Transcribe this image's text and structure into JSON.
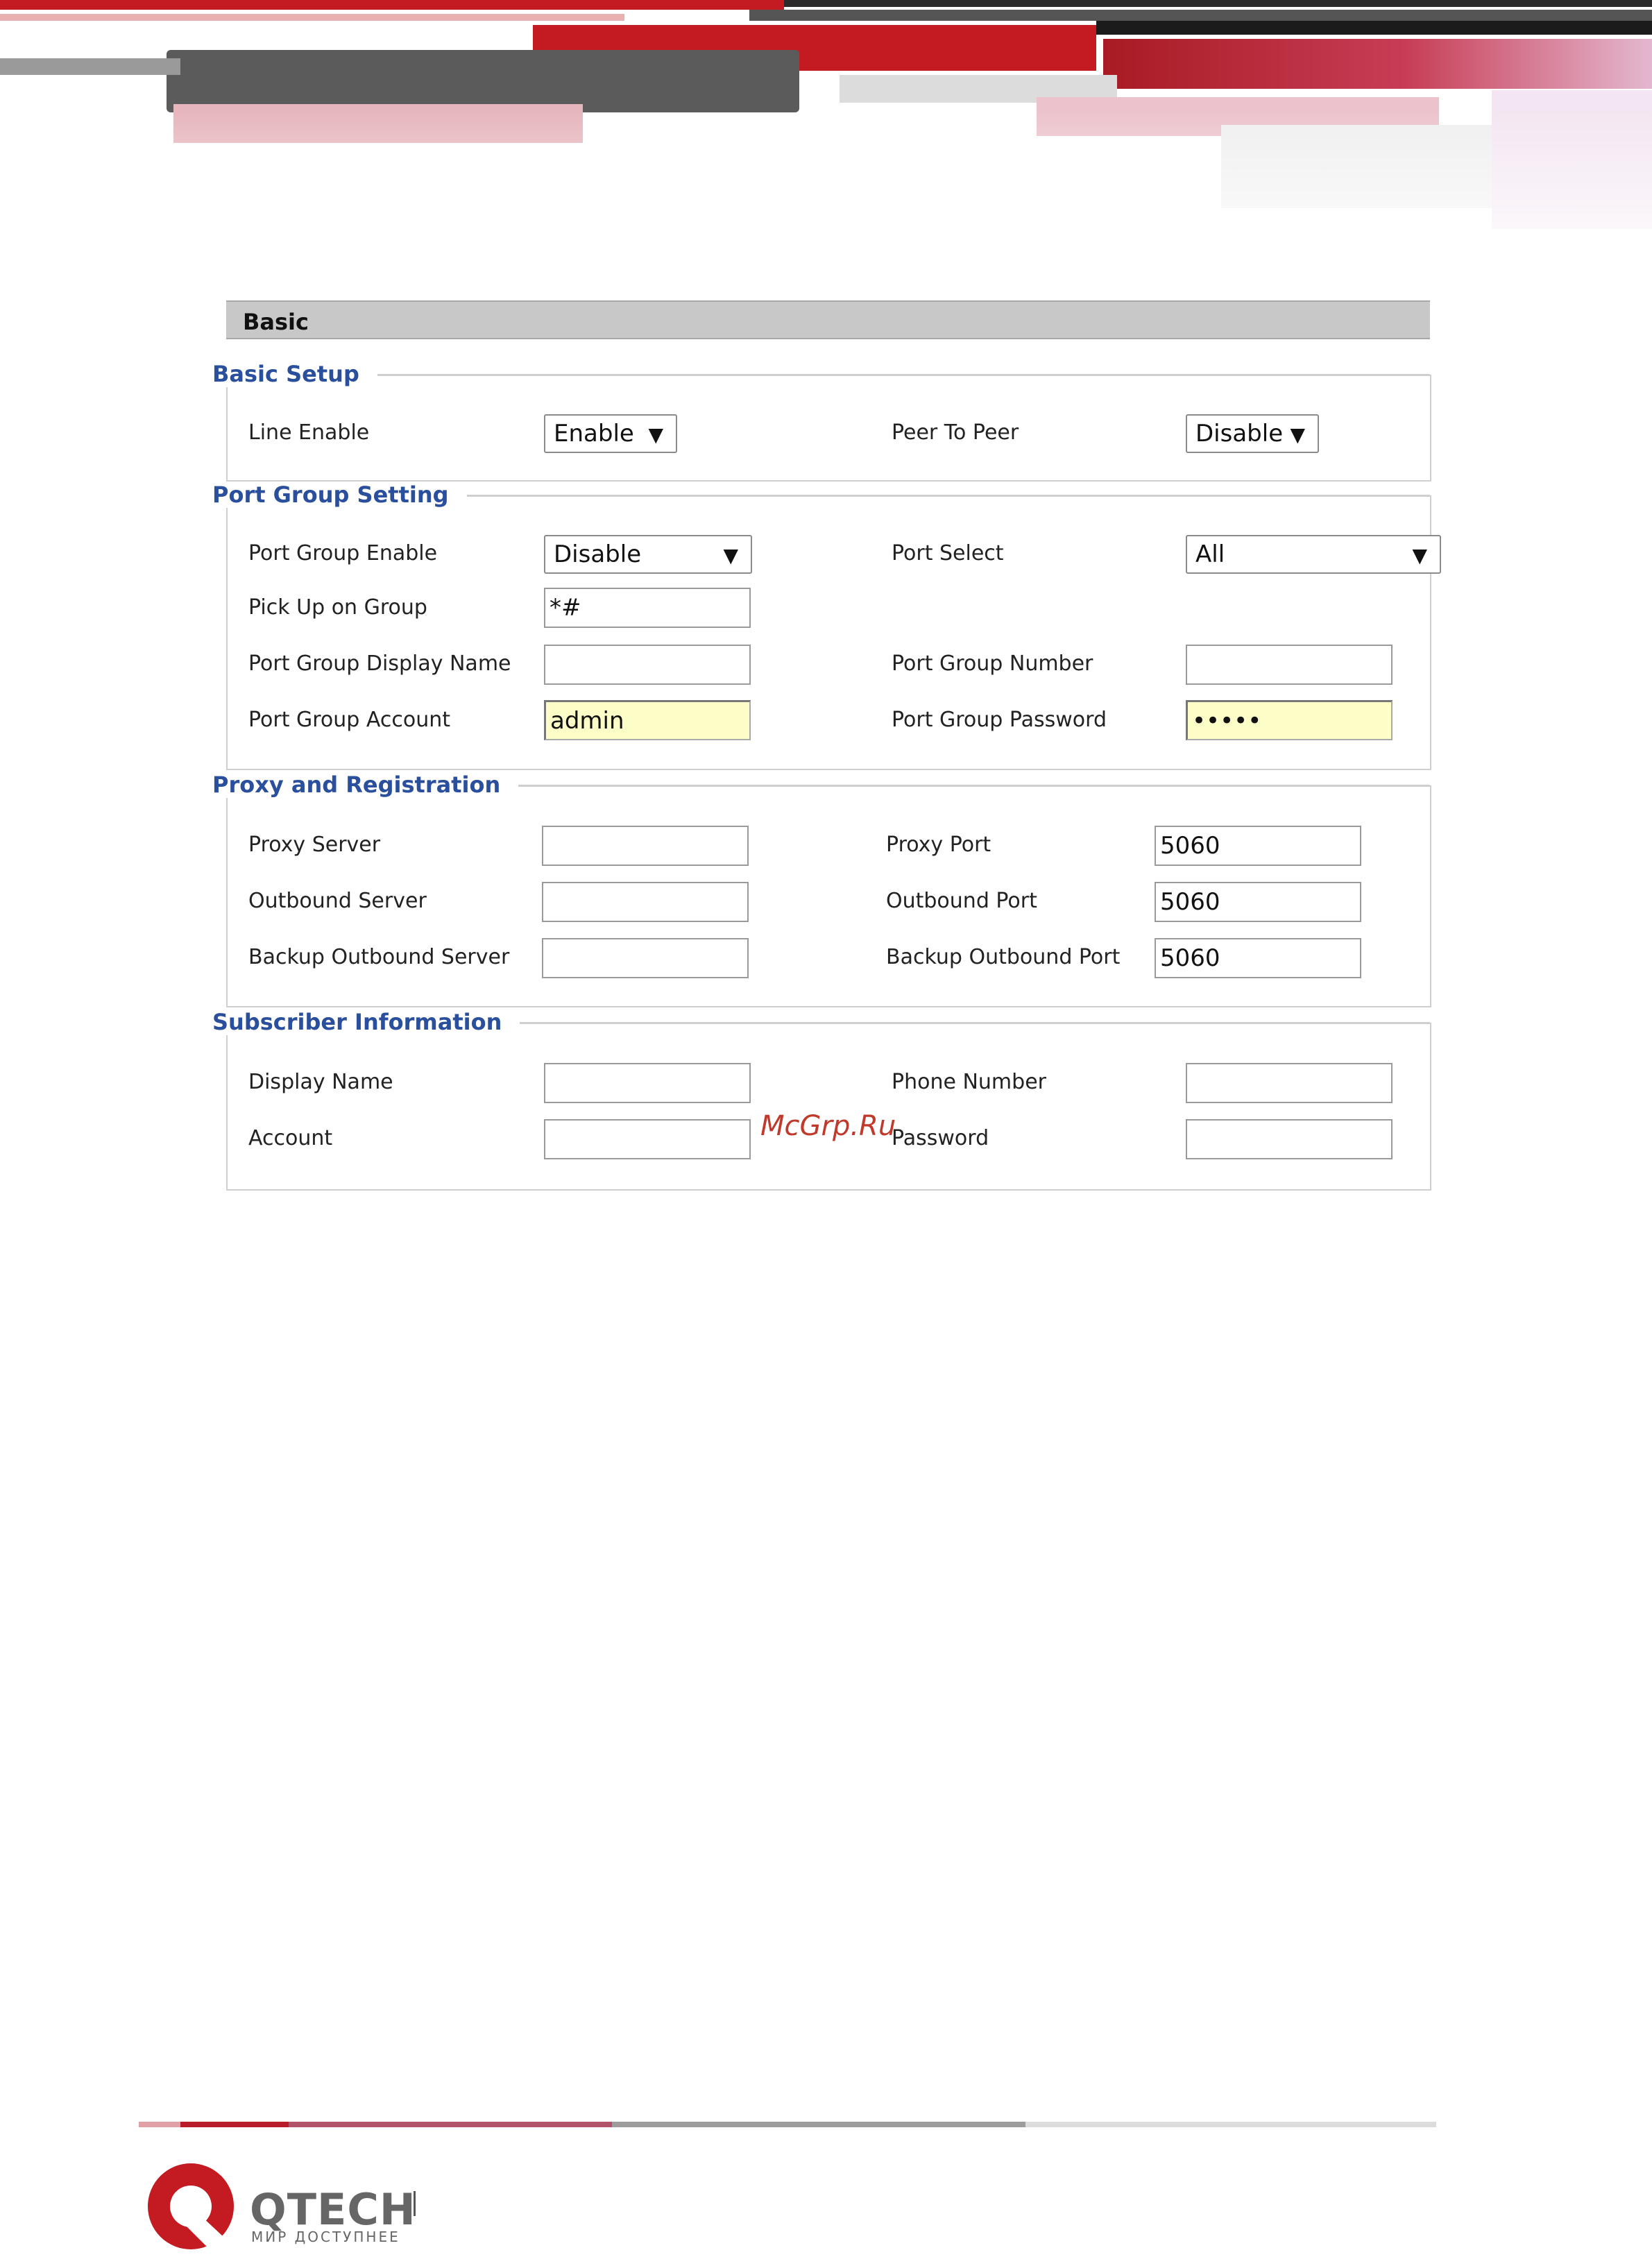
{
  "page": {
    "title": "Basic",
    "watermark": "McGrp.Ru"
  },
  "sections": {
    "basic_setup": {
      "title": "Basic Setup",
      "line_enable": {
        "label": "Line Enable",
        "value": "Enable"
      },
      "peer_to_peer": {
        "label": "Peer To Peer",
        "value": "Disable"
      }
    },
    "port_group_setting": {
      "title": "Port Group Setting",
      "port_group_enable": {
        "label": "Port Group Enable",
        "value": "Disable"
      },
      "port_select": {
        "label": "Port Select",
        "value": "All"
      },
      "pick_up_on_group": {
        "label": "Pick Up on Group",
        "value": "*#"
      },
      "port_group_display_name": {
        "label": "Port Group Display Name",
        "value": ""
      },
      "port_group_number": {
        "label": "Port Group Number",
        "value": ""
      },
      "port_group_account": {
        "label": "Port Group Account",
        "value": "admin"
      },
      "port_group_password": {
        "label": "Port Group Password",
        "value": "•••••"
      }
    },
    "proxy_and_registration": {
      "title": "Proxy and Registration",
      "proxy_server": {
        "label": "Proxy Server",
        "value": ""
      },
      "proxy_port": {
        "label": "Proxy Port",
        "value": "5060"
      },
      "outbound_server": {
        "label": "Outbound Server",
        "value": ""
      },
      "outbound_port": {
        "label": "Outbound Port",
        "value": "5060"
      },
      "backup_outbound_server": {
        "label": "Backup Outbound Server",
        "value": ""
      },
      "backup_outbound_port": {
        "label": "Backup Outbound Port",
        "value": "5060"
      }
    },
    "subscriber_information": {
      "title": "Subscriber Information",
      "display_name": {
        "label": "Display Name",
        "value": ""
      },
      "phone_number": {
        "label": "Phone Number",
        "value": ""
      },
      "account": {
        "label": "Account",
        "value": ""
      },
      "password": {
        "label": "Password",
        "value": ""
      }
    }
  },
  "dropdown_arrow": "▼",
  "footer": {
    "brand": "QTECH",
    "tagline": "МИР ДОСТУПНЕЕ"
  },
  "colors": {
    "section_title": "#2a4f9c",
    "brand_red": "#c0192b",
    "autofill_yellow": "#fdfdc8"
  }
}
